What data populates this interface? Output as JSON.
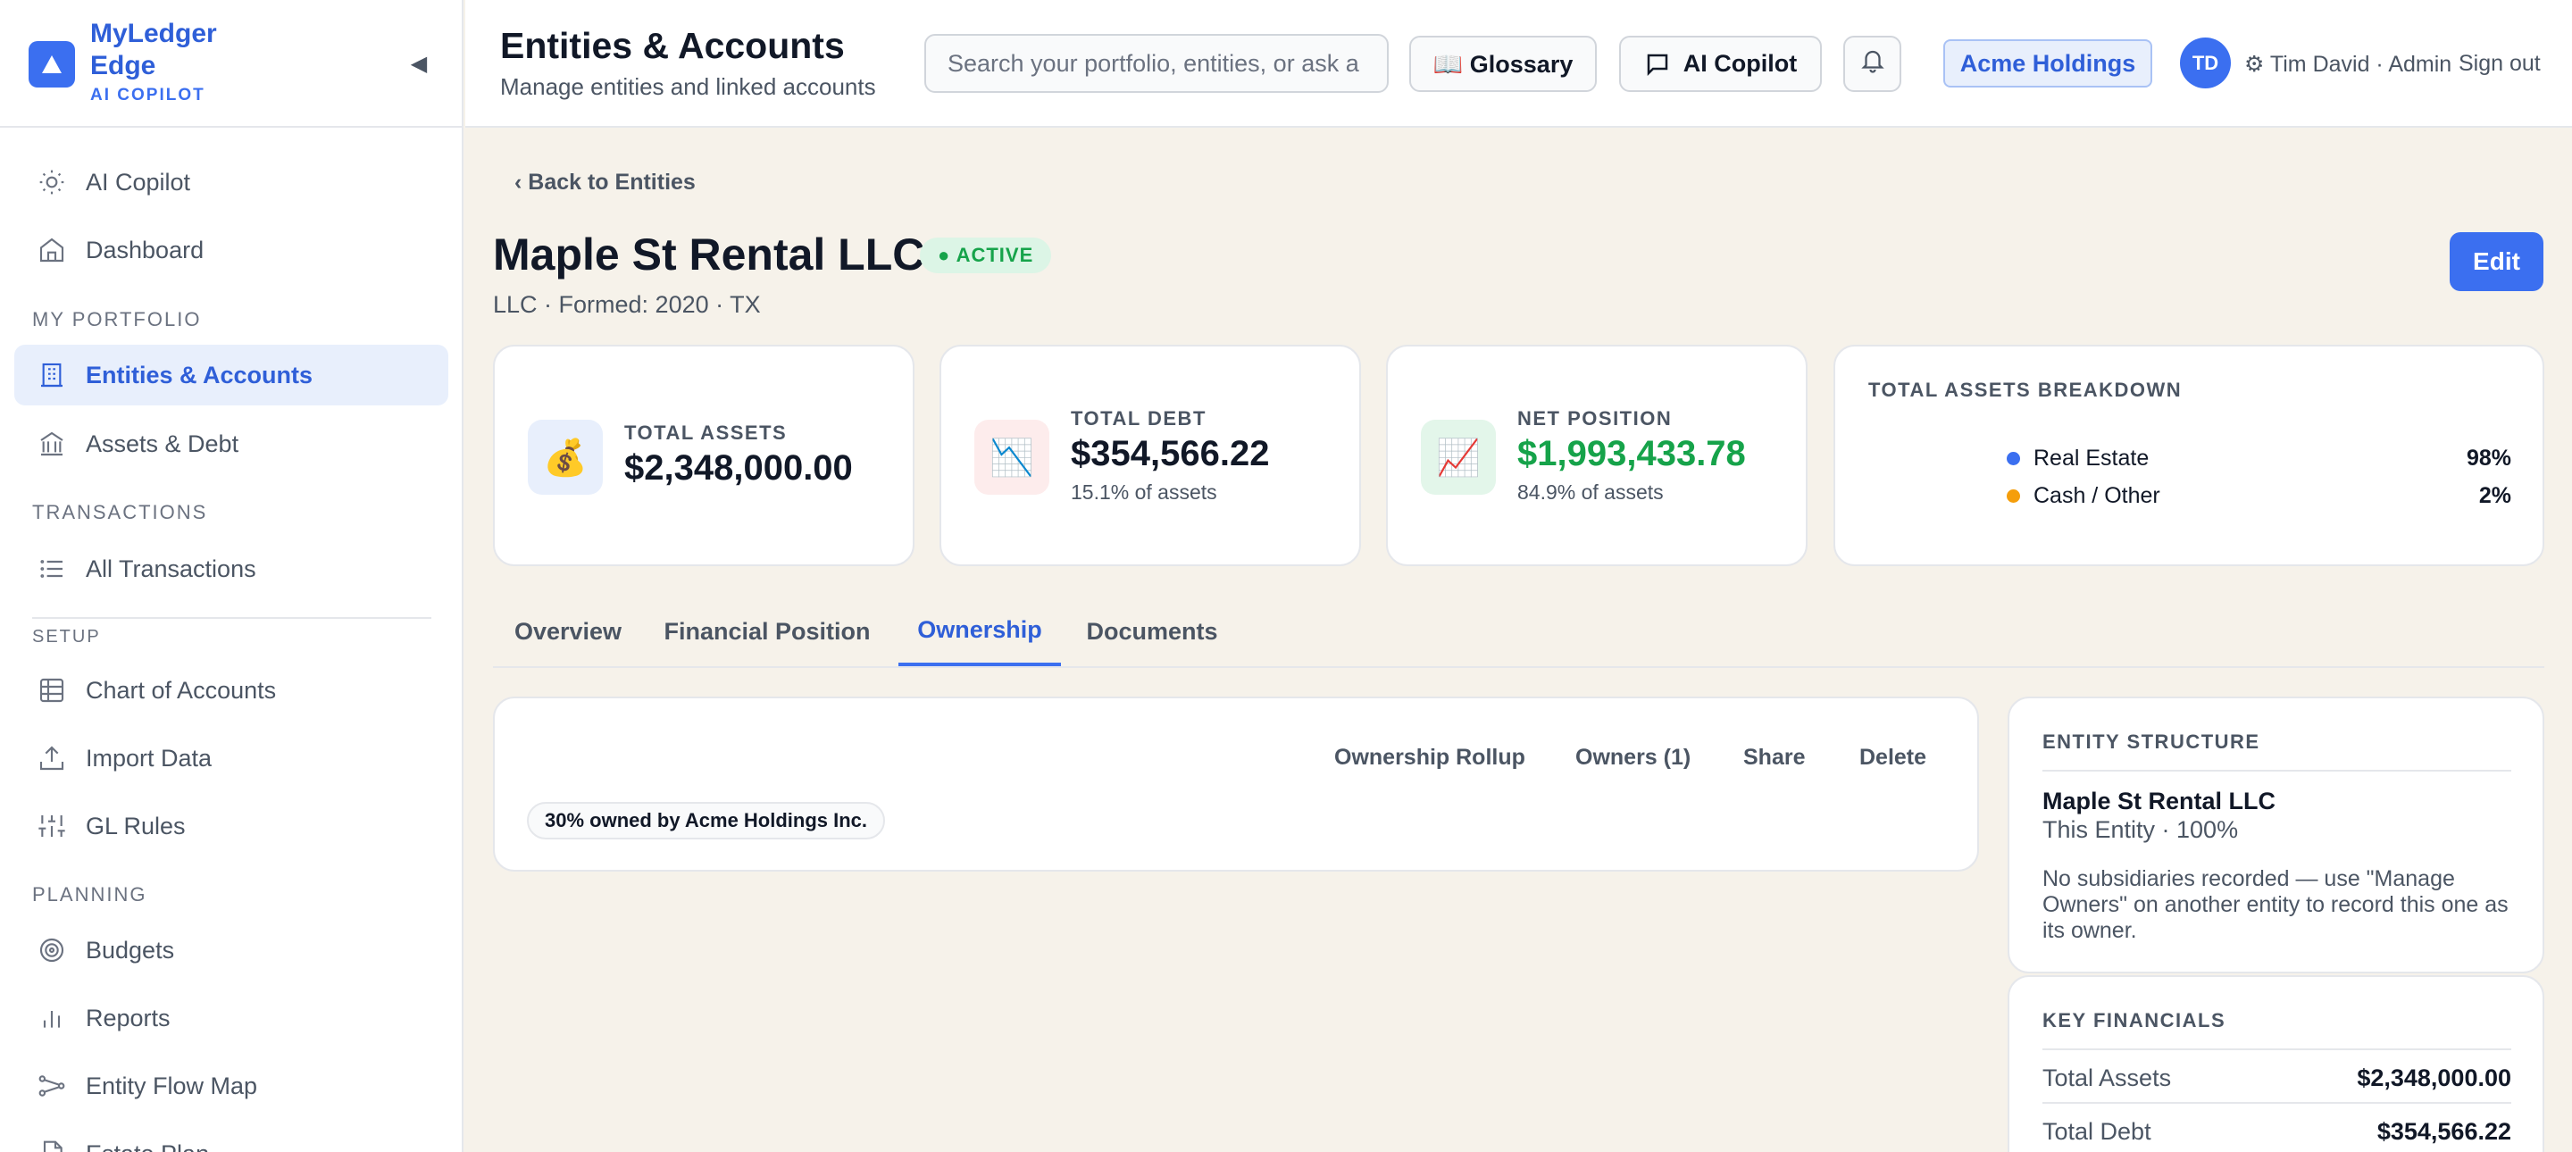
{
  "brand": {
    "name_line1": "MyLedger",
    "name_line2": "Edge",
    "subtitle": "AI COPILOT"
  },
  "sidebar": {
    "items": [
      {
        "label": "AI Copilot",
        "icon": "sun-icon"
      },
      {
        "label": "Dashboard",
        "icon": "home-icon"
      },
      {
        "label": "Entities & Accounts",
        "icon": "building-icon",
        "active": true
      },
      {
        "label": "Assets & Debt",
        "icon": "bank-icon"
      },
      {
        "label": "All Transactions",
        "icon": "list-icon"
      },
      {
        "label": "Chart of Accounts",
        "icon": "table-icon"
      },
      {
        "label": "Import Data",
        "icon": "upload-icon"
      },
      {
        "label": "GL Rules",
        "icon": "sliders-icon"
      },
      {
        "label": "Budgets",
        "icon": "target-icon"
      },
      {
        "label": "Reports",
        "icon": "bar-chart-icon"
      },
      {
        "label": "Entity Flow Map",
        "icon": "flow-icon"
      },
      {
        "label": "Estate Plan",
        "icon": "document-icon"
      }
    ],
    "sections": {
      "portfolio": "MY PORTFOLIO",
      "transactions": "TRANSACTIONS",
      "setup": "SETUP",
      "planning": "PLANNING"
    }
  },
  "header": {
    "title": "Entities & Accounts",
    "subtitle": "Manage entities and linked accounts",
    "search_placeholder": "Search your portfolio, entities, or ask a question...",
    "glossary": "📖 Glossary",
    "copilot": "AI Copilot",
    "entity_chip": "Acme Holdings",
    "avatar": "TD",
    "user": "⚙ Tim David · Admin",
    "signout": "Sign out"
  },
  "entity": {
    "back": "‹ Back to Entities",
    "name": "Maple St Rental LLC",
    "status": "● ACTIVE",
    "meta": "LLC · Formed: 2020 · TX",
    "edit": "Edit"
  },
  "stats": [
    {
      "label": "TOTAL ASSETS",
      "value": "$2,348,000.00",
      "icon": "💰"
    },
    {
      "label": "TOTAL DEBT",
      "value": "$354,566.22",
      "sub": "15.1% of assets",
      "icon": "📉"
    },
    {
      "label": "NET POSITION",
      "value": "$1,993,433.78",
      "sub": "84.9% of assets",
      "icon": "📈"
    }
  ],
  "breakdown": {
    "title": "TOTAL ASSETS BREAKDOWN",
    "rows": [
      {
        "label": "Real Estate",
        "pct": "98%",
        "color": "#3b6ff0"
      },
      {
        "label": "Cash / Other",
        "pct": "2%",
        "color": "#f59e0b"
      }
    ]
  },
  "tabs": [
    "Overview",
    "Financial Position",
    "Ownership",
    "Documents"
  ],
  "ownership": {
    "actions": [
      "Ownership Rollup",
      "Owners (1)",
      "Share",
      "Delete"
    ],
    "pill": "30% owned by Acme Holdings Inc."
  },
  "structure": {
    "title": "ENTITY STRUCTURE",
    "name": "Maple St Rental LLC",
    "sub": "This Entity · 100%",
    "note": "No subsidiaries recorded — use \"Manage Owners\" on another entity to record this one as its owner."
  },
  "key_financials": {
    "title": "KEY FINANCIALS",
    "rows": [
      {
        "label": "Total Assets",
        "value": "$2,348,000.00"
      },
      {
        "label": "Total Debt",
        "value": "$354,566.22"
      }
    ]
  }
}
